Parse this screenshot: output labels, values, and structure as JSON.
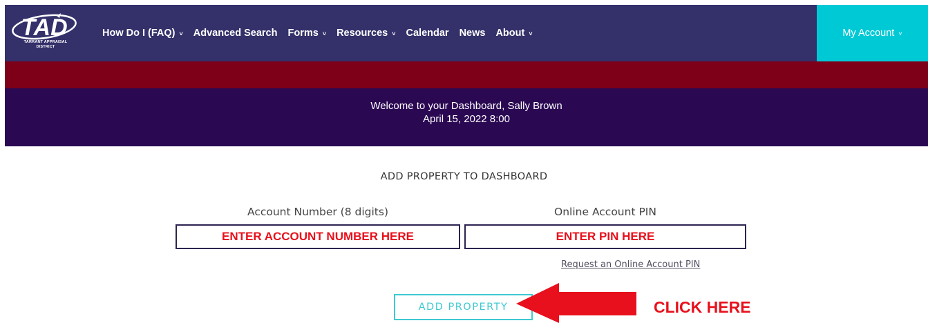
{
  "header": {
    "logo_text": "TAD",
    "logo_subtitle_line1": "TARRANT APPRAISAL",
    "logo_subtitle_line2": "DISTRICT",
    "nav": [
      {
        "label": "How Do I (FAQ)",
        "has_dropdown": true
      },
      {
        "label": "Advanced Search",
        "has_dropdown": false
      },
      {
        "label": "Forms",
        "has_dropdown": true
      },
      {
        "label": "Resources",
        "has_dropdown": true
      },
      {
        "label": "Calendar",
        "has_dropdown": false
      },
      {
        "label": "News",
        "has_dropdown": false
      },
      {
        "label": "About",
        "has_dropdown": true
      }
    ],
    "account_label": "My Account",
    "dropdown_glyph": "˅",
    "colors": {
      "nav_bg": "#33306a",
      "account_bg": "#00c9d6",
      "accent_bar": "#7d0018"
    }
  },
  "welcome": {
    "line1": "Welcome to your Dashboard, Sally Brown",
    "line2": "April 15, 2022 8:00",
    "bg": "#2a0852"
  },
  "form": {
    "title": "ADD PROPERTY TO DASHBOARD",
    "account_label": "Account Number (8 digits)",
    "account_value": "ENTER ACCOUNT NUMBER HERE",
    "pin_label": "Online Account PIN",
    "pin_value": "ENTER PIN HERE",
    "request_pin_link": "Request an Online Account PIN",
    "submit_label": "ADD PROPERTY"
  },
  "annotation": {
    "text": "CLICK HERE",
    "arrow_icon": "left-arrow-icon",
    "color": "#e8101c"
  }
}
